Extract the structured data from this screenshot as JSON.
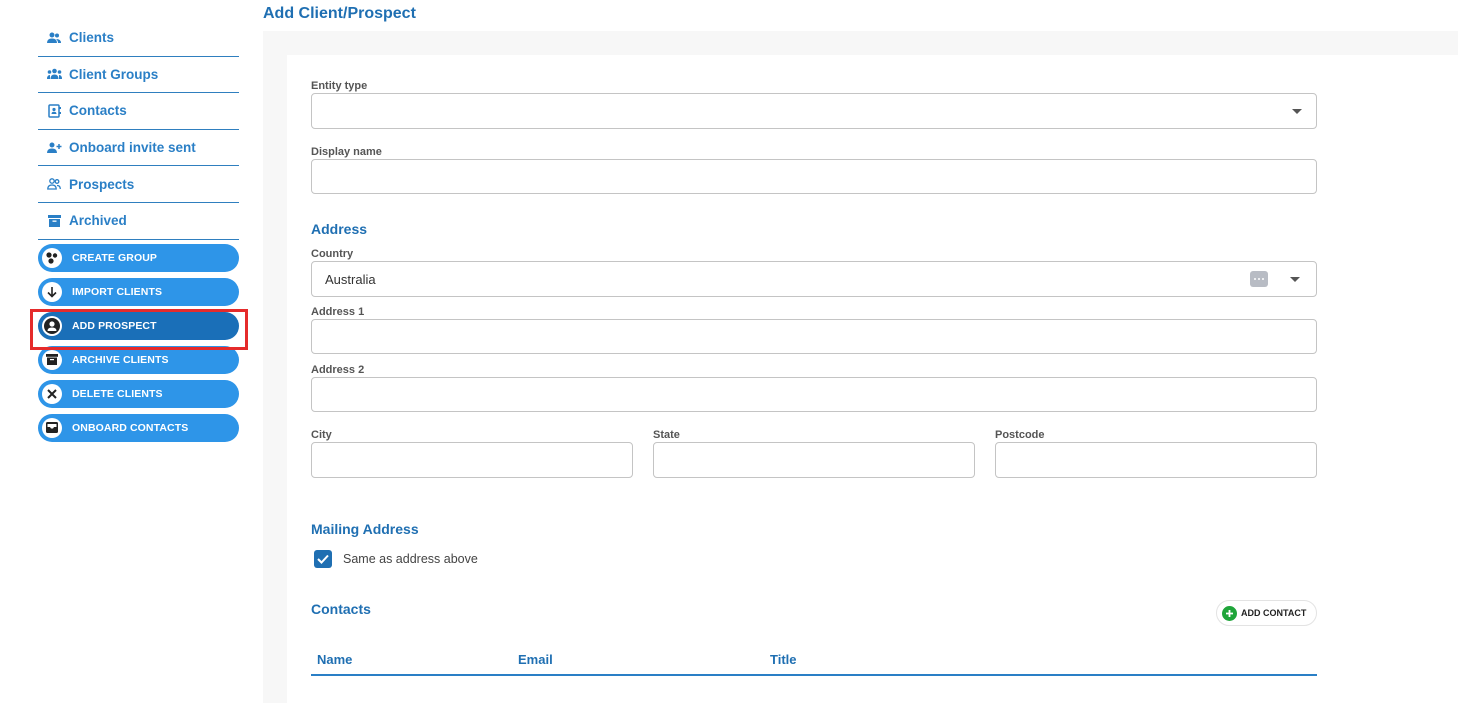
{
  "page": {
    "title": "Add Client/Prospect"
  },
  "sidebar": {
    "nav": [
      {
        "label": "Clients",
        "icon": "people-icon"
      },
      {
        "label": "Client Groups",
        "icon": "groups-icon"
      },
      {
        "label": "Contacts",
        "icon": "contact-book-icon"
      },
      {
        "label": "Onboard invite sent",
        "icon": "person-add-icon"
      },
      {
        "label": "Prospects",
        "icon": "people-outline-icon"
      },
      {
        "label": "Archived",
        "icon": "archive-icon"
      }
    ],
    "actions": [
      {
        "label": "CREATE GROUP",
        "icon": "group-circles-icon"
      },
      {
        "label": "IMPORT CLIENTS",
        "icon": "arrow-down-icon"
      },
      {
        "label": "ADD PROSPECT",
        "icon": "person-icon",
        "active": true
      },
      {
        "label": "ARCHIVE CLIENTS",
        "icon": "archive-box-icon"
      },
      {
        "label": "DELETE CLIENTS",
        "icon": "close-icon"
      },
      {
        "label": "ONBOARD CONTACTS",
        "icon": "inbox-icon"
      }
    ]
  },
  "form": {
    "entity_type": {
      "label": "Entity type",
      "value": ""
    },
    "display_name": {
      "label": "Display name",
      "value": ""
    },
    "address": {
      "title": "Address",
      "country": {
        "label": "Country",
        "value": "Australia"
      },
      "address1": {
        "label": "Address 1",
        "value": ""
      },
      "address2": {
        "label": "Address 2",
        "value": ""
      },
      "city": {
        "label": "City",
        "value": ""
      },
      "state": {
        "label": "State",
        "value": ""
      },
      "postcode": {
        "label": "Postcode",
        "value": ""
      }
    },
    "mailing": {
      "title": "Mailing Address",
      "same_as_above": {
        "label": "Same as address above",
        "checked": true
      }
    },
    "contacts": {
      "title": "Contacts",
      "add_label": "ADD CONTACT",
      "columns": [
        "Name",
        "Email",
        "Title"
      ]
    }
  },
  "colors": {
    "accent": "#1f6fb2",
    "button": "#2e95e8",
    "button_active": "#1a6fb8",
    "highlight": "#e52b2b",
    "add": "#1fa53a"
  }
}
